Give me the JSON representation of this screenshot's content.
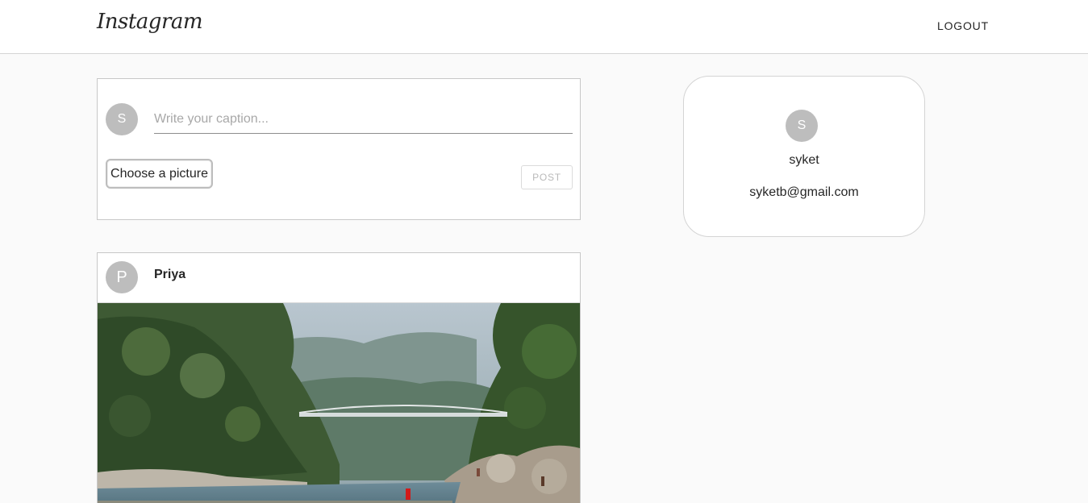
{
  "header": {
    "logo": "Instagram",
    "logout_label": "LOGOUT"
  },
  "composer": {
    "avatar_initial": "S",
    "caption_placeholder": "Write your caption...",
    "caption_value": "",
    "choose_label": "Choose a picture",
    "post_label": "POST"
  },
  "feed": {
    "posts": [
      {
        "avatar_initial": "P",
        "username": "Priya",
        "image_icon": "river-bridge-photo"
      }
    ]
  },
  "profile": {
    "avatar_initial": "S",
    "username": "syket",
    "email": "syketb@gmail.com"
  },
  "colors": {
    "background": "#fafafa",
    "avatar": "#bdbdbd",
    "border": "#c8c8c8",
    "text": "#262626"
  }
}
